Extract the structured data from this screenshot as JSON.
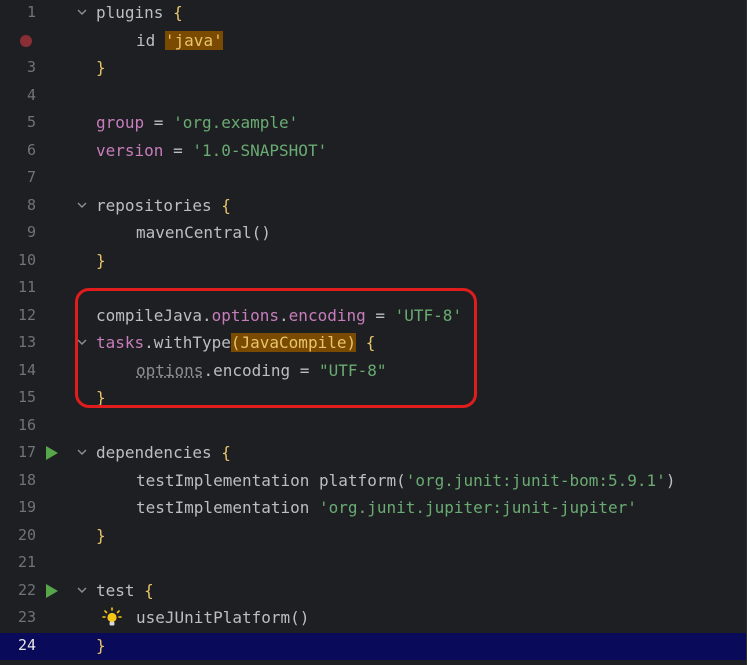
{
  "editor": {
    "current_line": 24,
    "lines": [
      {
        "no": "1",
        "fold": true,
        "tokens": [
          {
            "t": "plugins ",
            "c": ""
          },
          {
            "t": "{",
            "c": "brace gold"
          }
        ]
      },
      {
        "no": "",
        "breakpoint": true,
        "tokens": [
          {
            "t": "    ",
            "c": "indent"
          },
          {
            "t": "id ",
            "c": ""
          },
          {
            "t": "'java'",
            "c": "hl-str"
          }
        ]
      },
      {
        "no": "3",
        "tokens": [
          {
            "t": "}",
            "c": "brace gold"
          }
        ]
      },
      {
        "no": "4",
        "tokens": []
      },
      {
        "no": "5",
        "tokens": [
          {
            "t": "group",
            "c": "kw-purple"
          },
          {
            "t": " = ",
            "c": ""
          },
          {
            "t": "'org.example'",
            "c": "str"
          }
        ]
      },
      {
        "no": "6",
        "tokens": [
          {
            "t": "version",
            "c": "kw-purple"
          },
          {
            "t": " = ",
            "c": ""
          },
          {
            "t": "'1.0-SNAPSHOT'",
            "c": "str"
          }
        ]
      },
      {
        "no": "7",
        "tokens": []
      },
      {
        "no": "8",
        "fold": true,
        "tokens": [
          {
            "t": "repositories ",
            "c": ""
          },
          {
            "t": "{",
            "c": "brace gold"
          }
        ]
      },
      {
        "no": "9",
        "tokens": [
          {
            "t": "    ",
            "c": "indent"
          },
          {
            "t": "mavenCentral()",
            "c": ""
          }
        ]
      },
      {
        "no": "10",
        "tokens": [
          {
            "t": "}",
            "c": "brace gold"
          }
        ]
      },
      {
        "no": "11",
        "tokens": []
      },
      {
        "no": "12",
        "tokens": [
          {
            "t": "compileJava.",
            "c": ""
          },
          {
            "t": "options",
            "c": "kw-purple"
          },
          {
            "t": ".",
            "c": ""
          },
          {
            "t": "encoding",
            "c": "kw-purple"
          },
          {
            "t": " = ",
            "c": ""
          },
          {
            "t": "'UTF-8'",
            "c": "str"
          }
        ]
      },
      {
        "no": "13",
        "fold": true,
        "tokens": [
          {
            "t": "tasks",
            "c": "kw-purple"
          },
          {
            "t": ".withType",
            "c": ""
          },
          {
            "t": "(JavaCompile)",
            "c": "hl-paren"
          },
          {
            "t": " ",
            "c": ""
          },
          {
            "t": "{",
            "c": "brace gold"
          }
        ]
      },
      {
        "no": "14",
        "tokens": [
          {
            "t": "    ",
            "c": "indent"
          },
          {
            "t": "options",
            "c": "warn"
          },
          {
            "t": ".encoding = ",
            "c": ""
          },
          {
            "t": "\"UTF-8\"",
            "c": "str"
          }
        ]
      },
      {
        "no": "15",
        "tokens": [
          {
            "t": "}",
            "c": "brace gold"
          }
        ]
      },
      {
        "no": "16",
        "tokens": []
      },
      {
        "no": "17",
        "run": true,
        "fold": true,
        "tokens": [
          {
            "t": "dependencies ",
            "c": ""
          },
          {
            "t": "{",
            "c": "brace gold"
          }
        ]
      },
      {
        "no": "18",
        "tokens": [
          {
            "t": "    ",
            "c": "indent"
          },
          {
            "t": "testImplementation platform(",
            "c": ""
          },
          {
            "t": "'org.junit:junit-bom:5.9.1'",
            "c": "str"
          },
          {
            "t": ")",
            "c": ""
          }
        ]
      },
      {
        "no": "19",
        "tokens": [
          {
            "t": "    ",
            "c": "indent"
          },
          {
            "t": "testImplementation ",
            "c": ""
          },
          {
            "t": "'org.junit.jupiter:junit-jupiter'",
            "c": "str"
          }
        ]
      },
      {
        "no": "20",
        "tokens": [
          {
            "t": "}",
            "c": "brace gold"
          }
        ]
      },
      {
        "no": "21",
        "tokens": []
      },
      {
        "no": "22",
        "run": true,
        "fold": true,
        "tokens": [
          {
            "t": "test ",
            "c": ""
          },
          {
            "t": "{",
            "c": "brace gold"
          }
        ]
      },
      {
        "no": "23",
        "bulb": true,
        "tokens": [
          {
            "t": "    ",
            "c": "indent"
          },
          {
            "t": "useJUnitPlatform()",
            "c": ""
          }
        ]
      },
      {
        "no": "24",
        "tokens": [
          {
            "t": "}",
            "c": "brace gold"
          }
        ]
      }
    ]
  },
  "colors": {
    "background": "#1e1f22",
    "current_line": "#0a0a5a",
    "annotation": "#e01c1c",
    "string": "#6aab73",
    "keyword": "#c77dbb"
  },
  "icons": {
    "fold": "chevron-down-icon",
    "run": "run-gutter-icon",
    "breakpoint": "breakpoint-icon",
    "bulb": "lightbulb-icon"
  }
}
